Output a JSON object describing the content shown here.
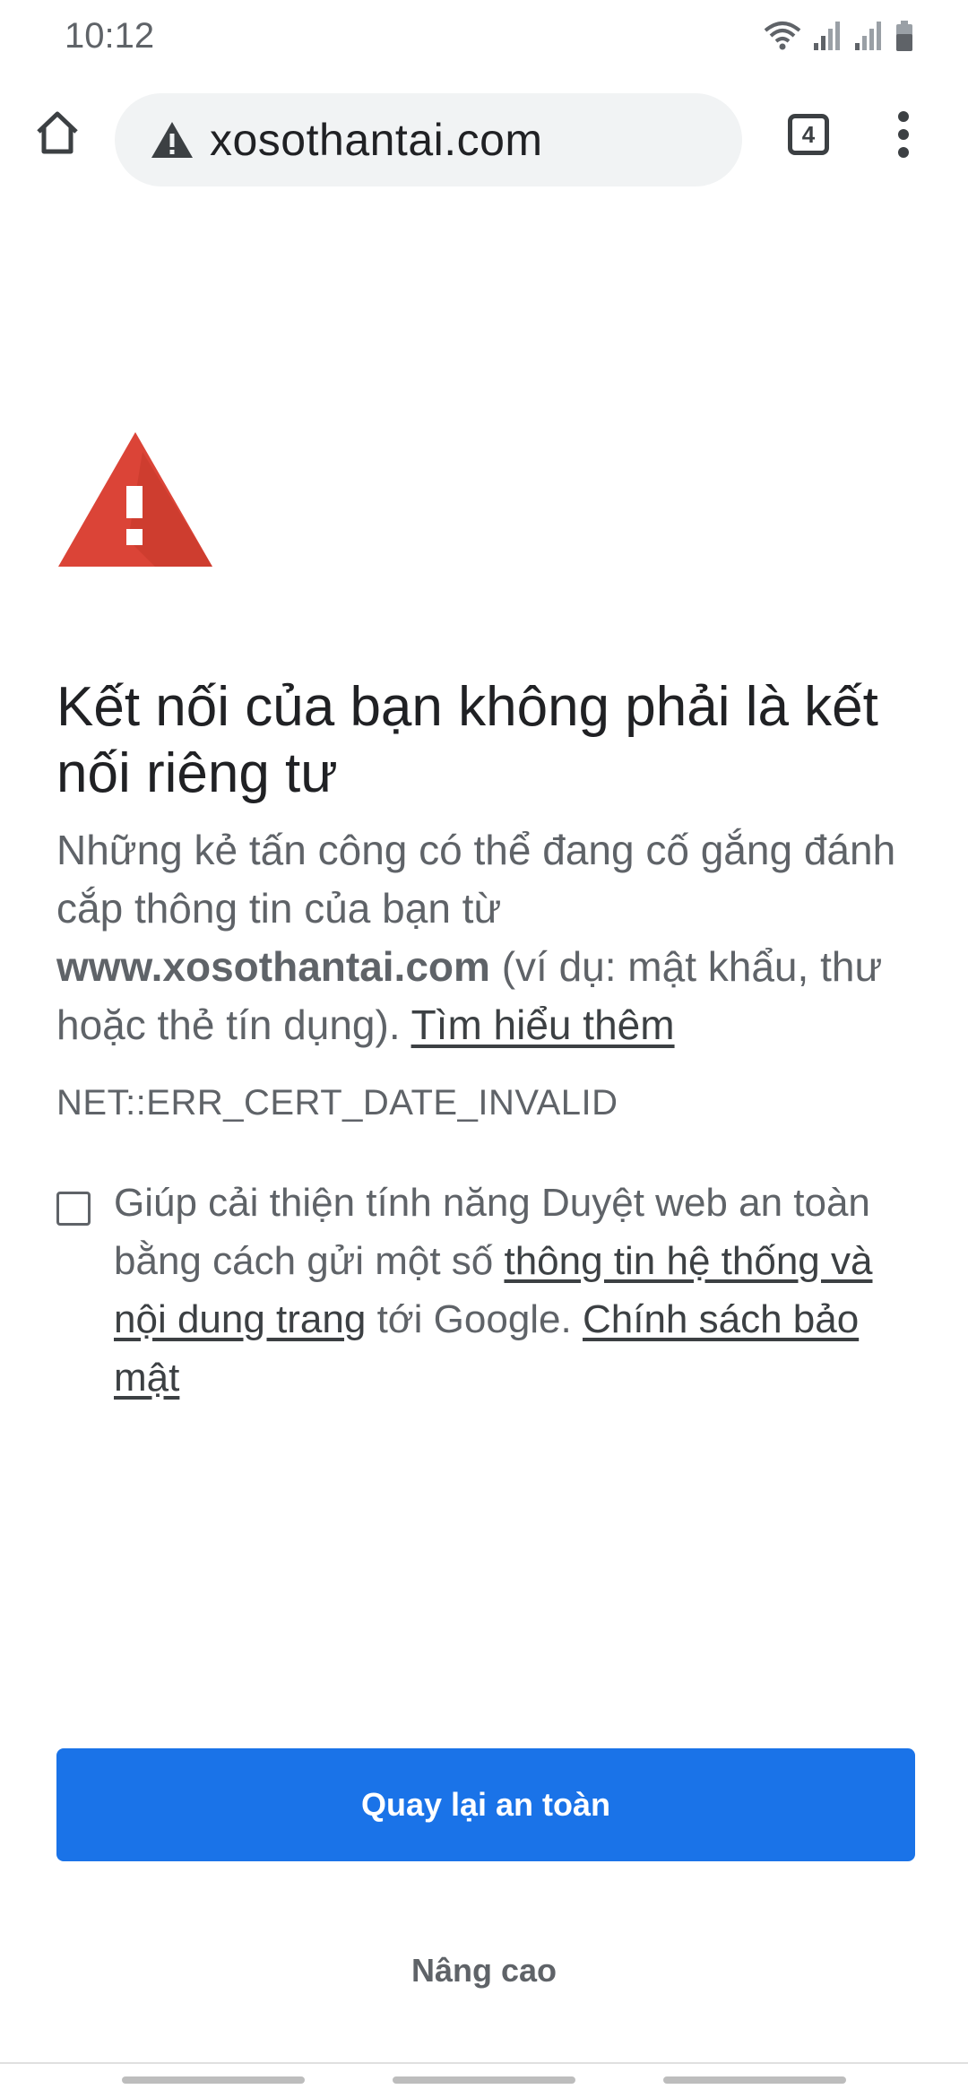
{
  "status_bar": {
    "time": "10:12",
    "icons": [
      "wifi-icon",
      "signal-icon",
      "signal-icon",
      "battery-icon"
    ]
  },
  "toolbar": {
    "url": "xosothantai.com",
    "tab_count": "4",
    "icons": [
      "home-icon",
      "warning-icon",
      "tabs-icon",
      "more-vert-icon"
    ]
  },
  "interstitial": {
    "icon": "warning-triangle-icon",
    "heading": "Kết nối của bạn không phải là kết nối riêng tư",
    "body_before": "Những kẻ tấn công có thể đang cố gắng đánh cắp thông tin của bạn từ ",
    "body_domain": "www.xosothantai.com",
    "body_after": " (ví dụ: mật khẩu, thư hoặc thẻ tín dụng). ",
    "learn_more": "Tìm hiểu thêm",
    "error_code": "NET::ERR_CERT_DATE_INVALID",
    "optin_before": "Giúp cải thiện tính năng Duyệt web an toàn bằng cách gửi một số ",
    "optin_link": "thông tin hệ thống và nội dung trang",
    "optin_middle": " tới Google. ",
    "privacy_link": "Chính sách bảo mật",
    "optin_checked": false
  },
  "buttons": {
    "back_to_safety": "Quay lại an toàn",
    "advanced": "Nâng cao"
  },
  "colors": {
    "primary": "#1a73e8",
    "warning_red": "#db4437",
    "omnibox_bg": "#f1f3f4"
  }
}
